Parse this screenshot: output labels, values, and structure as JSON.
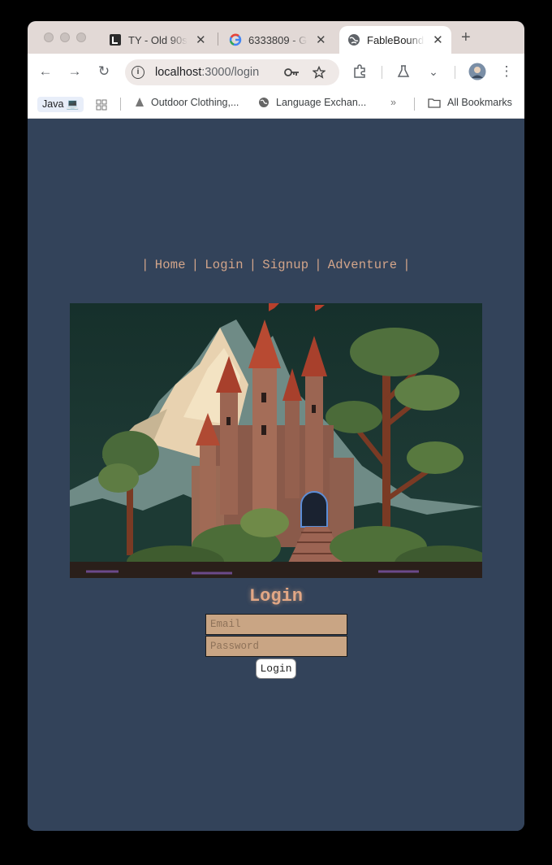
{
  "browser": {
    "tabs": [
      {
        "title": "TY - Old 90s",
        "icon": "letter-l-icon"
      },
      {
        "title": "6333809 - G",
        "icon": "google-icon"
      },
      {
        "title": "FableBound A",
        "icon": "globe-icon"
      }
    ],
    "active_tab_index": 2,
    "url_host": "localhost",
    "url_path": ":3000/login",
    "bookmarks": [
      {
        "label": "Java 💻",
        "icon": ""
      },
      {
        "label": "Outdoor Clothing,...",
        "icon": "tree-icon"
      },
      {
        "label": "Language Exchan...",
        "icon": "globe-icon"
      }
    ],
    "all_bookmarks_label": "All Bookmarks",
    "overflow_label": "»"
  },
  "nav": {
    "separator": "|",
    "items": [
      "Home",
      "Login",
      "Signup",
      "Adventure"
    ]
  },
  "hero": {
    "alt_icon": "pixel-art-castle-image"
  },
  "login": {
    "title": "Login",
    "email_placeholder": "Email",
    "password_placeholder": "Password",
    "button_label": "Login"
  },
  "colors": {
    "page_bg": "#33435a",
    "accent": "#d3a58a",
    "field_bg": "#c9a584"
  }
}
